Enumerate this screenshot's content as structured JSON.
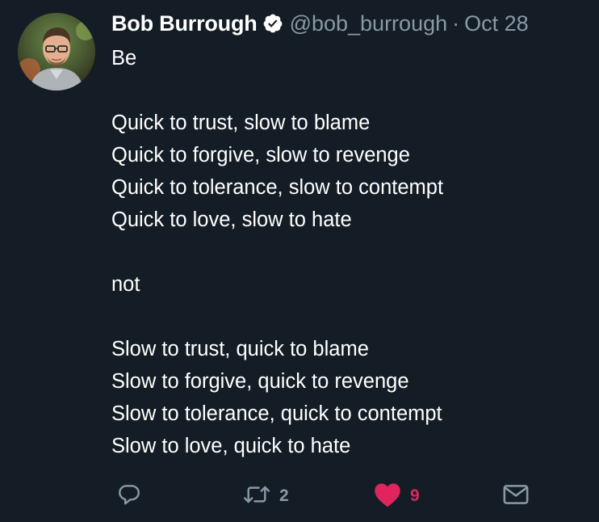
{
  "tweet": {
    "author": {
      "display_name": "Bob Burrough",
      "handle": "@bob_burrough",
      "verified_icon": "verified-badge-icon",
      "avatar": "profile-photo"
    },
    "separator": "·",
    "date": "Oct 28",
    "body_lines": [
      "Be",
      "",
      "Quick to trust, slow to blame",
      "Quick to forgive, slow to revenge",
      "Quick to tolerance, slow to contempt",
      "Quick to love, slow to hate",
      "",
      "not",
      "",
      "Slow to trust, quick to blame",
      "Slow to forgive, quick to revenge",
      "Slow to tolerance, quick to contempt",
      "Slow to love, quick to hate"
    ],
    "actions": {
      "reply": {
        "icon": "reply-icon"
      },
      "retweet": {
        "icon": "retweet-icon",
        "count": "2"
      },
      "like": {
        "icon": "heart-icon",
        "count": "9",
        "liked": true
      },
      "dm": {
        "icon": "envelope-icon"
      }
    }
  },
  "colors": {
    "background": "#141d26",
    "text": "#ffffff",
    "muted": "#8899a6",
    "like": "#e0245e"
  }
}
